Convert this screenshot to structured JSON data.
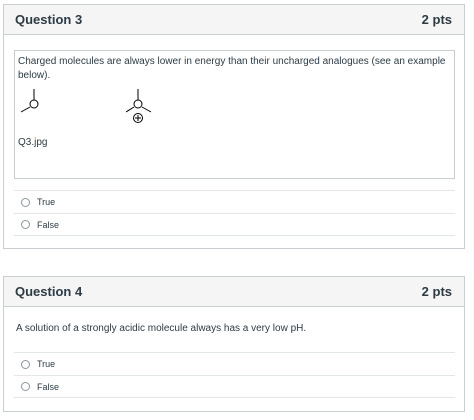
{
  "questions": [
    {
      "title": "Question 3",
      "points": "2 pts",
      "text": "Charged molecules are always lower in energy than their uncharged analogues (see an example below).",
      "image_caption": "Q3.jpg",
      "answers": [
        "True",
        "False"
      ]
    },
    {
      "title": "Question 4",
      "points": "2 pts",
      "text": "A solution of a strongly acidic molecule always has a very low pH.",
      "answers": [
        "True",
        "False"
      ]
    }
  ]
}
